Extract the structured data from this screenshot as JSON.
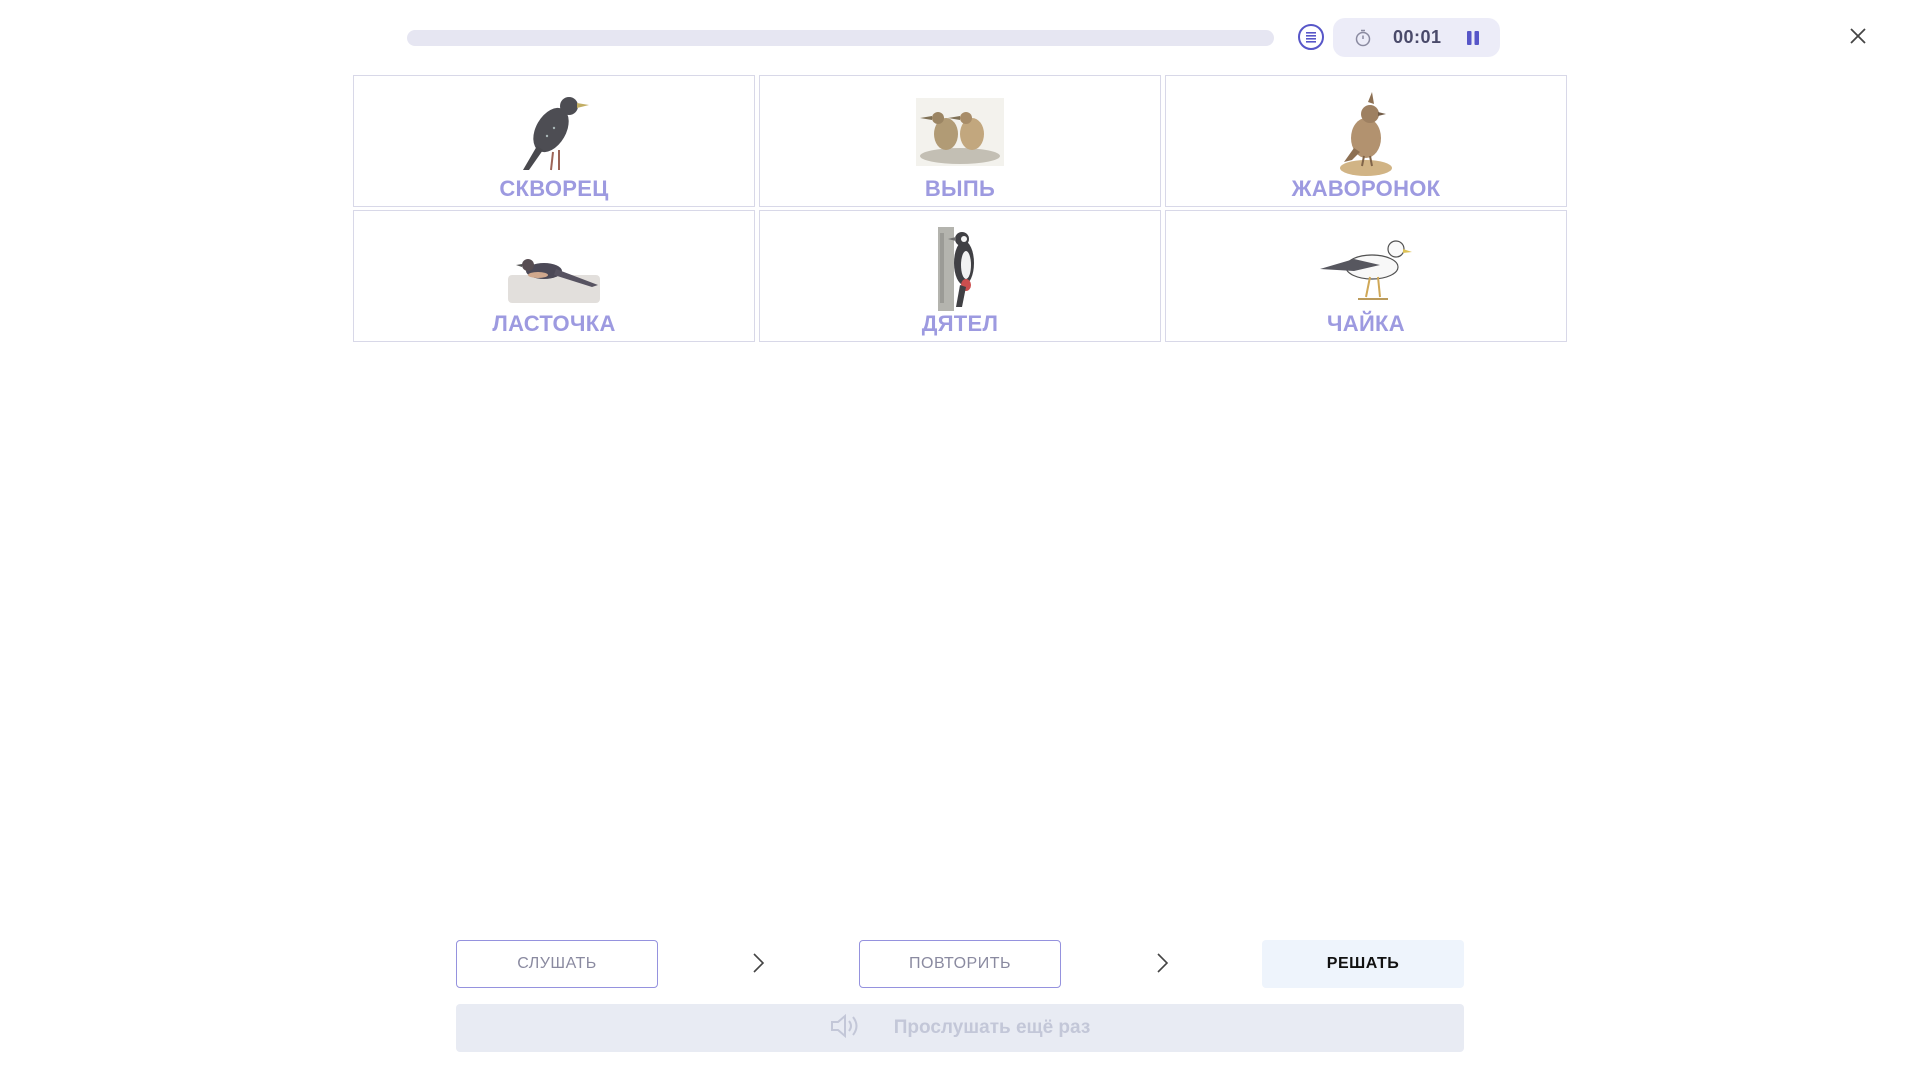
{
  "progress": {
    "fraction": 0.0
  },
  "timer": {
    "value": "00:01"
  },
  "cards": [
    {
      "label": "СКВОРЕЦ",
      "icon": "starling-image"
    },
    {
      "label": "ВЫПЬ",
      "icon": "bittern-image"
    },
    {
      "label": "ЖАВОРОНОК",
      "icon": "lark-image"
    },
    {
      "label": "ЛАСТОЧКА",
      "icon": "swallow-image"
    },
    {
      "label": "ДЯТЕЛ",
      "icon": "woodpecker-image"
    },
    {
      "label": "ЧАЙКА",
      "icon": "gull-image"
    }
  ],
  "steps": {
    "listen": "СЛУШАТЬ",
    "repeat": "ПОВТОРИТЬ",
    "solve": "РЕШАТЬ"
  },
  "replay": {
    "label": "Прослушать ещё раз",
    "icon": "speaker-icon"
  },
  "colors": {
    "accent": "#5756c8",
    "label": "#9d9ae0",
    "track": "#e6e6f2"
  }
}
